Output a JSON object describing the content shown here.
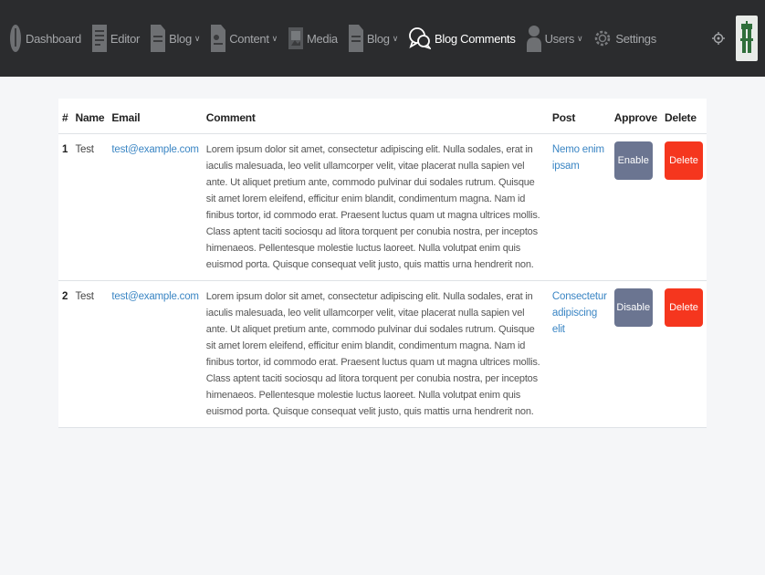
{
  "nav": {
    "items": [
      {
        "label": "Dashboard",
        "icon": "dashboard-icon",
        "active": false,
        "dropdown": false
      },
      {
        "label": "Editor",
        "icon": "editor-icon",
        "active": false,
        "dropdown": false
      },
      {
        "label": "Blog",
        "icon": "blog-icon",
        "active": false,
        "dropdown": true
      },
      {
        "label": "Content",
        "icon": "content-icon",
        "active": false,
        "dropdown": true
      },
      {
        "label": "Media",
        "icon": "media-icon",
        "active": false,
        "dropdown": false
      },
      {
        "label": "Blog",
        "icon": "blog-icon",
        "active": false,
        "dropdown": true
      },
      {
        "label": "Blog Comments",
        "icon": "comments-icon",
        "active": true,
        "dropdown": false
      },
      {
        "label": "Users",
        "icon": "users-icon",
        "active": false,
        "dropdown": true
      },
      {
        "label": "Settings",
        "icon": "settings-icon",
        "active": false,
        "dropdown": false
      }
    ],
    "caret": "∨"
  },
  "table": {
    "headers": {
      "num": "#",
      "name": "Name",
      "email": "Email",
      "comment": "Comment",
      "post": "Post",
      "approve": "Approve",
      "delete": "Delete"
    },
    "rows": [
      {
        "num": "1",
        "name": "Test",
        "email": "test@example.com",
        "comment": "Lorem ipsum dolor sit amet, consectetur adipiscing elit. Nulla sodales, erat in iaculis malesuada, leo velit ullamcorper velit, vitae placerat nulla sapien vel ante. Ut aliquet pretium ante, commodo pulvinar dui sodales rutrum. Quisque sit amet lorem eleifend, efficitur enim blandit, condimentum magna. Nam id finibus tortor, id commodo erat. Praesent luctus quam ut magna ultrices mollis. Class aptent taciti sociosqu ad litora torquent per conubia nostra, per inceptos himenaeos. Pellentesque molestie luctus laoreet. Nulla volutpat enim quis euismod porta. Quisque consequat velit justo, quis mattis urna hendrerit non.",
        "post": "Nemo enim ipsam",
        "approve_label": "Enable",
        "delete_label": "Delete"
      },
      {
        "num": "2",
        "name": "Test",
        "email": "test@example.com",
        "comment": "Lorem ipsum dolor sit amet, consectetur adipiscing elit. Nulla sodales, erat in iaculis malesuada, leo velit ullamcorper velit, vitae placerat nulla sapien vel ante. Ut aliquet pretium ante, commodo pulvinar dui sodales rutrum. Quisque sit amet lorem eleifend, efficitur enim blandit, condimentum magna. Nam id finibus tortor, id commodo erat. Praesent luctus quam ut magna ultrices mollis. Class aptent taciti sociosqu ad litora torquent per conubia nostra, per inceptos himenaeos. Pellentesque molestie luctus laoreet. Nulla volutpat enim quis euismod porta. Quisque consequat velit justo, quis mattis urna hendrerit non.",
        "post": "Consectetur adipiscing elit",
        "approve_label": "Disable",
        "delete_label": "Delete"
      }
    ]
  },
  "colors": {
    "navbar_bg": "#2b2c2e",
    "page_bg": "#f5f6f8",
    "link": "#3b86c4",
    "approve_btn": "#6b7591",
    "delete_btn": "#f5361e"
  }
}
